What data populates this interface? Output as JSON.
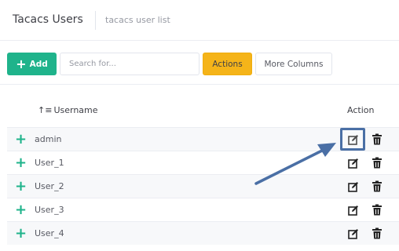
{
  "header": {
    "title": "Tacacs Users",
    "subtitle": "tacacs user list"
  },
  "toolbar": {
    "add_label": "Add",
    "search_placeholder": "Search for...",
    "actions_label": "Actions",
    "more_columns_label": "More Columns"
  },
  "table": {
    "columns": {
      "username": "Username",
      "action": "Action"
    },
    "rows": [
      {
        "username": "admin"
      },
      {
        "username": "User_1"
      },
      {
        "username": "User_2"
      },
      {
        "username": "User_3"
      },
      {
        "username": "User_4"
      }
    ]
  },
  "colors": {
    "accent": "#1fb38b",
    "actions": "#f5b419",
    "annotation": "#4a6fa5"
  },
  "icons": {
    "expand": "plus-icon",
    "edit": "edit-icon",
    "delete": "trash-icon",
    "sort": "sort-icon"
  }
}
